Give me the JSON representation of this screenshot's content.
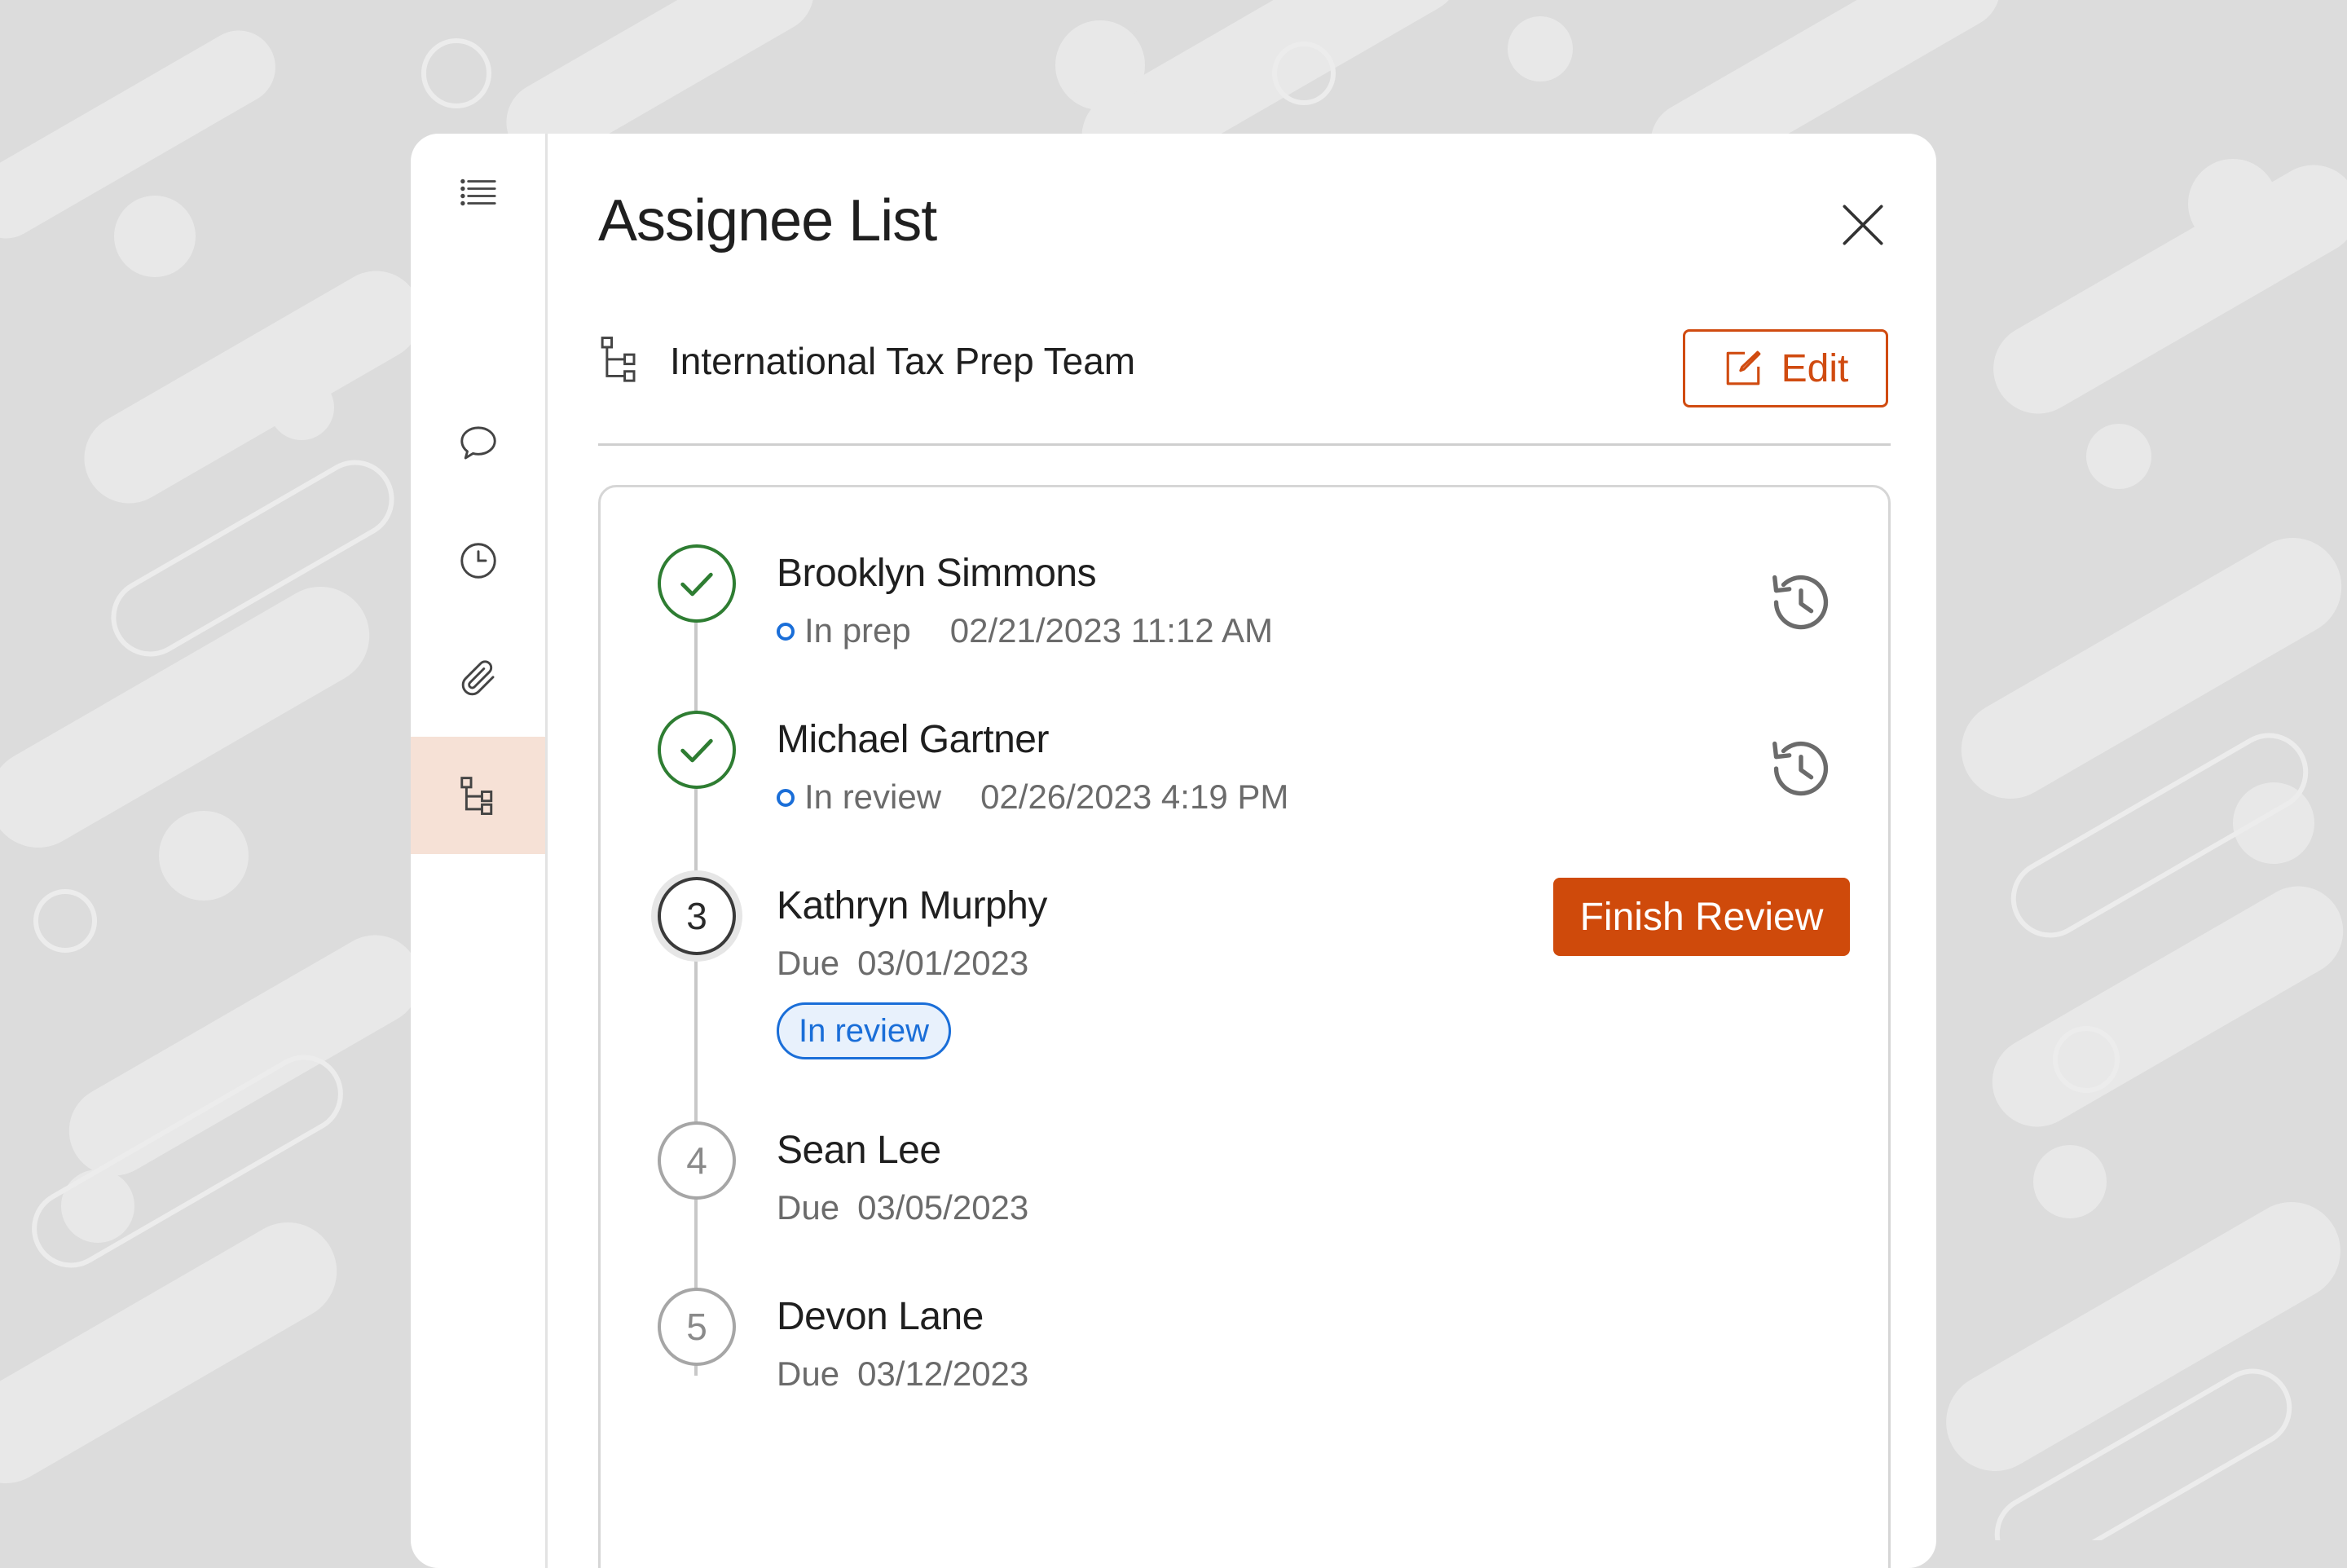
{
  "sidebar": {
    "items": [
      {
        "name": "list-icon"
      },
      {
        "name": "comment-icon"
      },
      {
        "name": "clock-icon"
      },
      {
        "name": "paperclip-icon"
      },
      {
        "name": "hierarchy-icon",
        "active": true
      }
    ]
  },
  "panel": {
    "title": "Assignee List",
    "close_icon": "close-icon"
  },
  "team": {
    "icon": "hierarchy-icon",
    "name": "International Tax Prep Team",
    "edit_label": "Edit"
  },
  "assignees": [
    {
      "step": "done",
      "name": "Brooklyn Simmons",
      "status": "In prep",
      "timestamp": "02/21/2023 11:12 AM",
      "has_history": true
    },
    {
      "step": "done",
      "name": "Michael Gartner",
      "status": "In review",
      "timestamp": "02/26/2023 4:19 PM",
      "has_history": true
    },
    {
      "step": "3",
      "name": "Kathryn Murphy",
      "due_label": "Due",
      "due_date": "03/01/2023",
      "status_pill": "In review",
      "action_label": "Finish Review"
    },
    {
      "step": "4",
      "name": "Sean Lee",
      "due_label": "Due",
      "due_date": "03/05/2023"
    },
    {
      "step": "5",
      "name": "Devon Lane",
      "due_label": "Due",
      "due_date": "03/12/2023"
    }
  ],
  "colors": {
    "accent": "#cf4a0b",
    "success": "#2e7d32",
    "status_blue": "#1a6ed8",
    "active_rail_bg": "#f6e1d6"
  }
}
